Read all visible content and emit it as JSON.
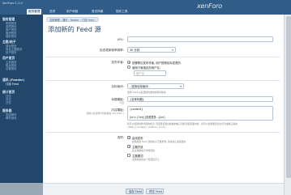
{
  "app": {
    "version": "XenForo 1.2.0",
    "logo": "xenForo",
    "topbar_right": ""
  },
  "topbar": {
    "tabs": [
      {
        "label": "服务管理"
      },
      {
        "label": "选项"
      },
      {
        "label": "用户和组"
      },
      {
        "label": "首页风格"
      },
      {
        "label": "插件工具"
      }
    ]
  },
  "sidebar": {
    "groups": [
      {
        "head": "服务管理",
        "items": [
          "系统首页",
          "选项首页",
          "用户首页",
          "版块首页",
          "插件首页"
        ]
      },
      {
        "head": "主题/帖子",
        "items": [
          "前台首页",
          "前台主题首页",
          "帖子首页"
        ]
      },
      {
        "head": "用户首页",
        "items": [
          "主页首页",
          "前台首页",
          "访客首页"
        ]
      },
      {
        "head": "通讯 (Feeder)",
        "items": [
          "订阅 Feed"
        ]
      },
      {
        "head": "统计首页",
        "items": [
          "日志",
          "月日",
          "日志"
        ]
      },
      {
        "head": "服务器",
        "items": [
          "发送邮件",
          "邮件首页"
        ]
      },
      {
        "head": "",
        "items": [
          "",
          ""
        ]
      }
    ]
  },
  "breadcrumbs": "控制管理 › 通讯 › Feeder › 订阅 Feed ›",
  "page": {
    "title": "添加新的 Feed 源"
  },
  "form": {
    "url_label": "URL:",
    "url_value": "",
    "frequency_label": "检查更新频率频率:",
    "frequency_value": "30 分钟",
    "author_label": "发布作者:",
    "author_options": [
      {
        "label": "放置帮论发布作者, 用户按照实际发表的.",
        "selected": true
      },
      {
        "label": "使用下面指定的用户名:",
        "selected": false
      }
    ],
    "author_username_placeholder": "用户名 ...",
    "forum_label": "目标版块:",
    "forum_value": "- 选择目标版块 -",
    "forum_hint": "选择 Feed 从此源的的发布的目标版块",
    "title_label": "标题模板:",
    "title_sublabel": "可选",
    "title_value": "{名称标题}",
    "content_label": "内容模板:",
    "content_sublabel": "使用以及替换代码的模版 (RS Code )",
    "content_lines": [
      "{content}",
      "",
      "[url={'link}]查看更多...[/url]"
    ],
    "content_hint_1": "您可以使用替换代码的标记, 您需要设置好模板的帖子目标列表里面内容 - 您可以使用和您建立符号或帖子等的",
    "content_hint_2": "{title} {content} {author} {link}",
    "options_label": "选项:",
    "options": [
      {
        "label": "启用发布",
        "desc": "启用后此 Feed 源的帖子已发布到, 请将禁止的后更好.",
        "checked": true
      },
      {
        "label": "主题开放",
        "desc": "此主题的帖子作者回复.",
        "checked": true
      },
      {
        "label": "主题置顶",
        "desc": "主题将会在这个置顶显示上.",
        "checked": false
      }
    ]
  },
  "buttons": {
    "save": "保存 Feed",
    "preview": "预览 Feed"
  }
}
